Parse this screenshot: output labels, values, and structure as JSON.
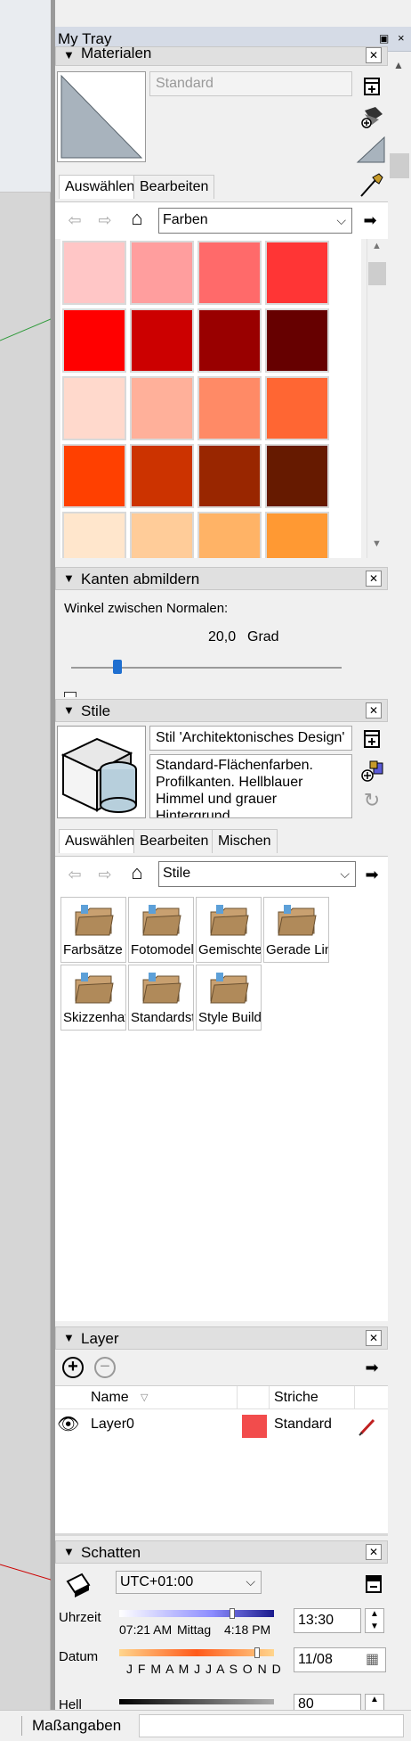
{
  "tray": {
    "title": "My Tray",
    "pin_icon": "pin-icon",
    "close_glyph": "×"
  },
  "materials": {
    "header_label": "Materialen",
    "material_name_placeholder": "Standard",
    "tabs": [
      "Auswählen",
      "Bearbeiten"
    ],
    "library": "Farben",
    "swatch_colors": [
      "#ffc6c6",
      "#ff9e9e",
      "#ff6a6a",
      "#ff3535",
      "#ff0000",
      "#cc0000",
      "#990000",
      "#660000",
      "#ffd9cc",
      "#ffb09a",
      "#ff8a66",
      "#ff6633",
      "#ff4000",
      "#cc3300",
      "#992600",
      "#661a00",
      "#ffe6cc",
      "#ffcc99",
      "#ffb366",
      "#ff9933"
    ]
  },
  "soften": {
    "header_label": "Kanten abmildern",
    "angle_label": "Winkel zwischen Normalen:",
    "angle_value": "20,0",
    "angle_unit": "Grad",
    "slider_fraction": 0.17
  },
  "styles": {
    "header_label": "Stile",
    "style_name": "Stil 'Architektonisches Design'",
    "description": "Standard-Flächenfarben. Profilkanten. Hellblauer Himmel und grauer Hintergrund.",
    "tabs": [
      "Auswählen",
      "Bearbeiten",
      "Mischen"
    ],
    "library": "Stile",
    "folders": [
      "Farbsätze",
      "Fotomodellierung",
      "Gemischte Stile",
      "Gerade Linien",
      "Skizzenhafte Kanten",
      "Standardstile",
      "Style Builder"
    ]
  },
  "layer": {
    "header_label": "Layer",
    "col_name": "Name",
    "col_dashes": "Striche",
    "rows": [
      {
        "name": "Layer0",
        "color": "#f24c4c",
        "dashes": "Standard"
      }
    ]
  },
  "shadows": {
    "header_label": "Schatten",
    "timezone": "UTC+01:00",
    "time_label": "Uhrzeit",
    "time_ticks": [
      "07:21 AM",
      "Mittag",
      "4:18 PM"
    ],
    "time_value": "13:30",
    "date_label": "Datum",
    "date_ticks": "J F M A M J J A S O N D",
    "date_value": "11/08",
    "light_label": "Hell",
    "light_value": "80"
  },
  "status_bar": {
    "measure_label": "Maßangaben",
    "measure_value": ""
  },
  "accent": {
    "model_red": "#cc0000",
    "axis_green": "#2e9a3a",
    "slider_blue": "#1f6fd0"
  }
}
